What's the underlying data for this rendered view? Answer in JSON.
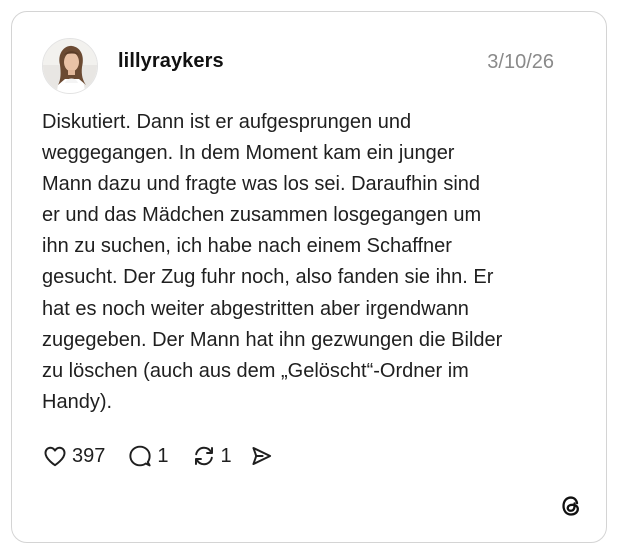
{
  "post": {
    "username": "lillyraykers",
    "date": "3/10/26",
    "text": "Diskutiert. Dann ist er aufgesprungen und\nweggegangen. In dem Moment kam ein junger\nMann dazu und fragte was los sei. Daraufhin sind\ner und das Mädchen zusammen losgegangen um\nihn zu suchen, ich habe nach einem Schaffner\ngesucht. Der Zug fuhr noch, also fanden sie ihn. Er\nhat es noch weiter abgestritten aber irgendwann\nzugegeben. Der Mann hat ihn gezwungen die Bilder\nzu löschen (auch aus dem „Gelöscht“-Ordner im\nHandy).",
    "likes": "397",
    "replies": "1",
    "reposts": "1"
  },
  "icons": {
    "like": "heart-icon",
    "reply": "speech-bubble-icon",
    "repost": "repost-icon",
    "share": "send-icon",
    "brand": "threads-logo-icon"
  },
  "colors": {
    "text": "#1f1f1f",
    "muted": "#8a8a8a",
    "border": "#d4d4d4",
    "background": "#ffffff"
  }
}
